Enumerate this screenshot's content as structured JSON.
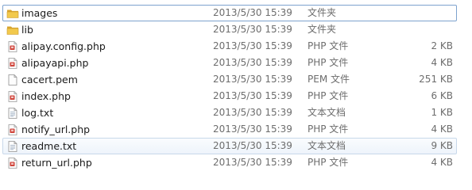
{
  "files": [
    {
      "name": "images",
      "date": "2013/5/30 15:39",
      "type": "文件夹",
      "size": "",
      "icon": "folder-icon"
    },
    {
      "name": "lib",
      "date": "2013/5/30 15:39",
      "type": "文件夹",
      "size": "",
      "icon": "folder-icon"
    },
    {
      "name": "alipay.config.php",
      "date": "2013/5/30 15:39",
      "type": "PHP 文件",
      "size": "2 KB",
      "icon": "php-file-icon"
    },
    {
      "name": "alipayapi.php",
      "date": "2013/5/30 15:39",
      "type": "PHP 文件",
      "size": "4 KB",
      "icon": "php-file-icon"
    },
    {
      "name": "cacert.pem",
      "date": "2013/5/30 15:39",
      "type": "PEM 文件",
      "size": "251 KB",
      "icon": "blank-file-icon"
    },
    {
      "name": "index.php",
      "date": "2013/5/30 15:39",
      "type": "PHP 文件",
      "size": "6 KB",
      "icon": "php-file-icon"
    },
    {
      "name": "log.txt",
      "date": "2013/5/30 15:39",
      "type": "文本文档",
      "size": "1 KB",
      "icon": "text-file-icon"
    },
    {
      "name": "notify_url.php",
      "date": "2013/5/30 15:39",
      "type": "PHP 文件",
      "size": "4 KB",
      "icon": "php-file-icon"
    },
    {
      "name": "readme.txt",
      "date": "2013/5/30 15:39",
      "type": "文本文档",
      "size": "9 KB",
      "icon": "text-file-icon"
    },
    {
      "name": "return_url.php",
      "date": "2013/5/30 15:39",
      "type": "PHP 文件",
      "size": "4 KB",
      "icon": "php-file-icon"
    }
  ],
  "colors": {
    "folder": "#e8b83a",
    "php_accent": "#d0463c",
    "focus_border": "#7da2ce",
    "hover_border": "#c8d8ea",
    "secondary_text": "#6d6d6d"
  }
}
